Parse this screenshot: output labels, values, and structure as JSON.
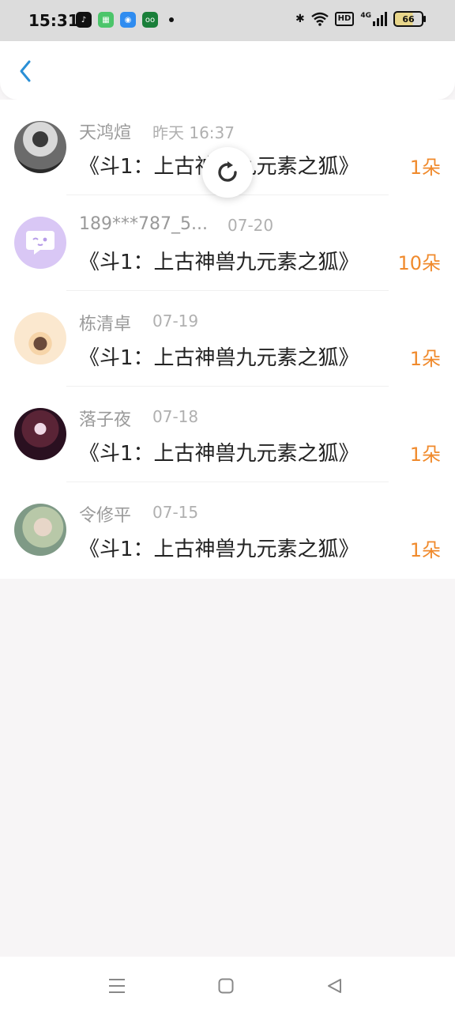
{
  "status_bar": {
    "time": "15:31",
    "apps": [
      "tiktok-icon",
      "grocery-app-icon",
      "browser-icon",
      "oppo-app-icon"
    ],
    "hd_label": "HD",
    "network_label": "4G",
    "battery": "66"
  },
  "header": {
    "back_icon": "chevron-left-icon"
  },
  "list": {
    "items": [
      {
        "name": "天鸿煊",
        "date": "昨天 16:37",
        "title": "《斗1：上古神兽九元素之狐》",
        "count": "1朵"
      },
      {
        "name": "189***787_5...",
        "date": "07-20",
        "title": "《斗1：上古神兽九元素之狐》",
        "count": "10朵"
      },
      {
        "name": "栋清卓",
        "date": "07-19",
        "title": "《斗1：上古神兽九元素之狐》",
        "count": "1朵"
      },
      {
        "name": "落子夜",
        "date": "07-18",
        "title": "《斗1：上古神兽九元素之狐》",
        "count": "1朵"
      },
      {
        "name": "令修平",
        "date": "07-15",
        "title": "《斗1：上古神兽九元素之狐》",
        "count": "1朵"
      }
    ]
  },
  "colors": {
    "accent": "#2a8fd6",
    "count": "#f08a2c"
  }
}
